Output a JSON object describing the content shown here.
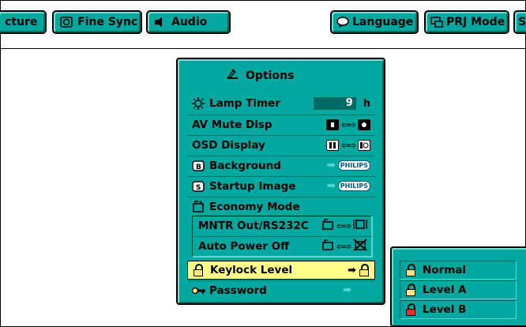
{
  "menu": {
    "tabs": [
      {
        "label": "cture",
        "icon": "picture-icon"
      },
      {
        "label": "Fine Sync",
        "icon": "fine-sync-icon"
      },
      {
        "label": "Audio",
        "icon": "speaker-icon"
      },
      {
        "label": "Language",
        "icon": "speech-bubble-icon"
      },
      {
        "label": "PRJ Mode",
        "icon": "prj-mode-icon"
      },
      {
        "label": "S",
        "icon": ""
      }
    ]
  },
  "options": {
    "title": "Options",
    "lamp_timer": {
      "label": "Lamp Timer",
      "value": "9",
      "unit": "h"
    },
    "av_mute": {
      "label": "AV Mute Disp"
    },
    "osd_display": {
      "label": "OSD Display"
    },
    "background": {
      "label": "Background",
      "badge": "PHILIPS"
    },
    "startup_image": {
      "label": "Startup Image",
      "badge": "PHILIPS"
    },
    "economy_mode": {
      "label": "Economy Mode"
    },
    "mntr_out": {
      "label": "MNTR Out/RS232C"
    },
    "auto_power_off": {
      "label": "Auto Power Off"
    },
    "keylock_level": {
      "label": "Keylock Level"
    },
    "password": {
      "label": "Password"
    }
  },
  "keylock_menu": {
    "items": [
      {
        "label": "Normal",
        "lock_color": "#ffe680"
      },
      {
        "label": "Level A",
        "lock_color": "#ffe680"
      },
      {
        "label": "Level B",
        "lock_color": "#e03030"
      }
    ]
  },
  "colors": {
    "panel": "#00a8a0",
    "highlight": "#ffff88",
    "value_box": "#006a64"
  }
}
